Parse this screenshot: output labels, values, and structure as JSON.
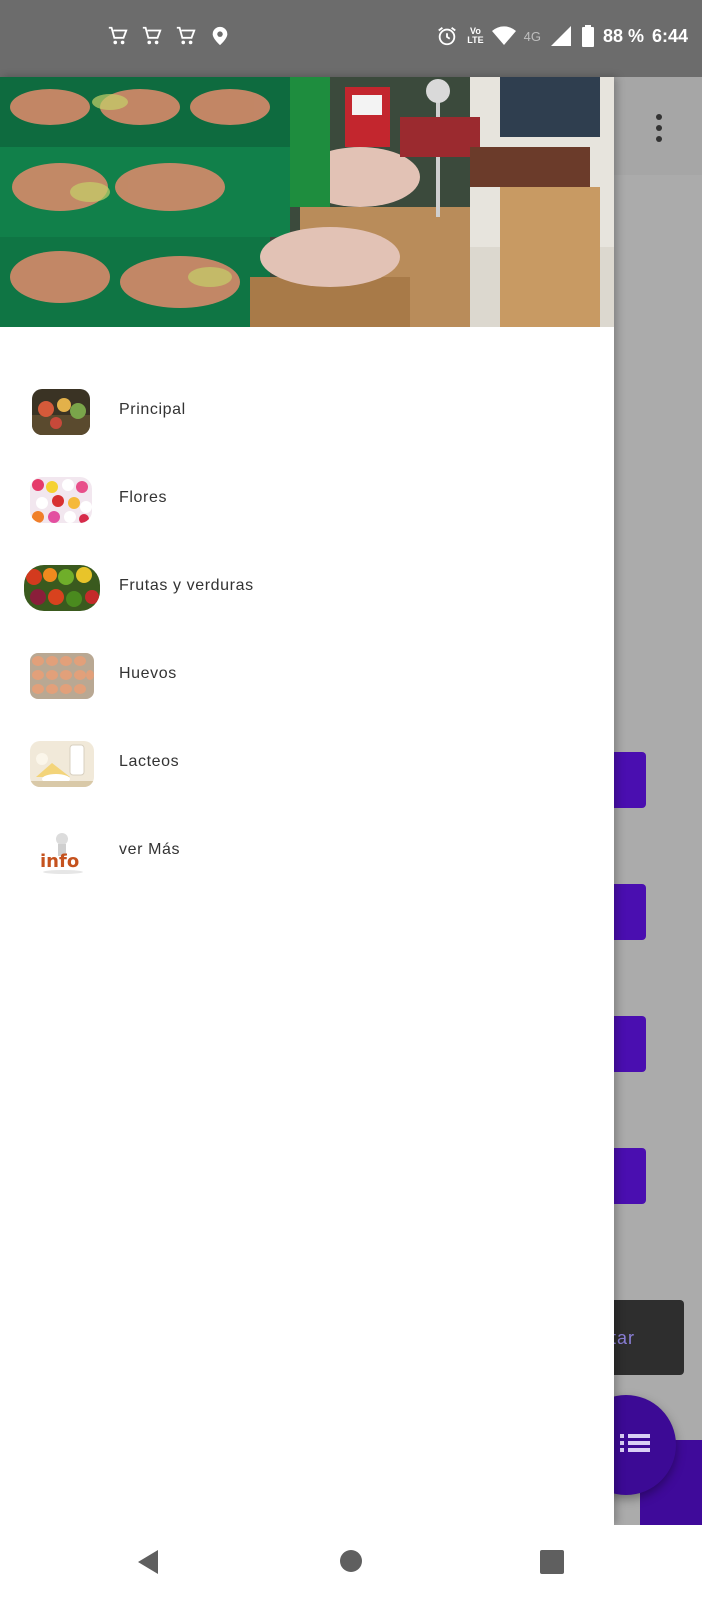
{
  "status_bar": {
    "left_icons": [
      "cart-icon",
      "cart-icon",
      "cart-icon",
      "location-pin-icon"
    ],
    "volte_top": "Vo",
    "volte_bottom": "LTE",
    "network": "4G",
    "battery": "88 %",
    "time": "6:44"
  },
  "drawer": {
    "menu": [
      {
        "label": "Principal",
        "icon": "store-thumbnail"
      },
      {
        "label": "Flores",
        "icon": "flowers-thumbnail"
      },
      {
        "label": "Frutas y verduras",
        "icon": "produce-thumbnail"
      },
      {
        "label": "Huevos",
        "icon": "eggs-thumbnail"
      },
      {
        "label": "Lacteos",
        "icon": "dairy-thumbnail"
      },
      {
        "label": "ver Más",
        "icon": "info-thumbnail"
      }
    ]
  },
  "background_app": {
    "snackbar_text": "ptar",
    "fab_icon": "list-icon",
    "overflow_icon": "more-vert-icon"
  },
  "colors": {
    "accent": "#4a0eb0",
    "status_bar": "#6c6c6c",
    "scrim": "#ababab"
  }
}
